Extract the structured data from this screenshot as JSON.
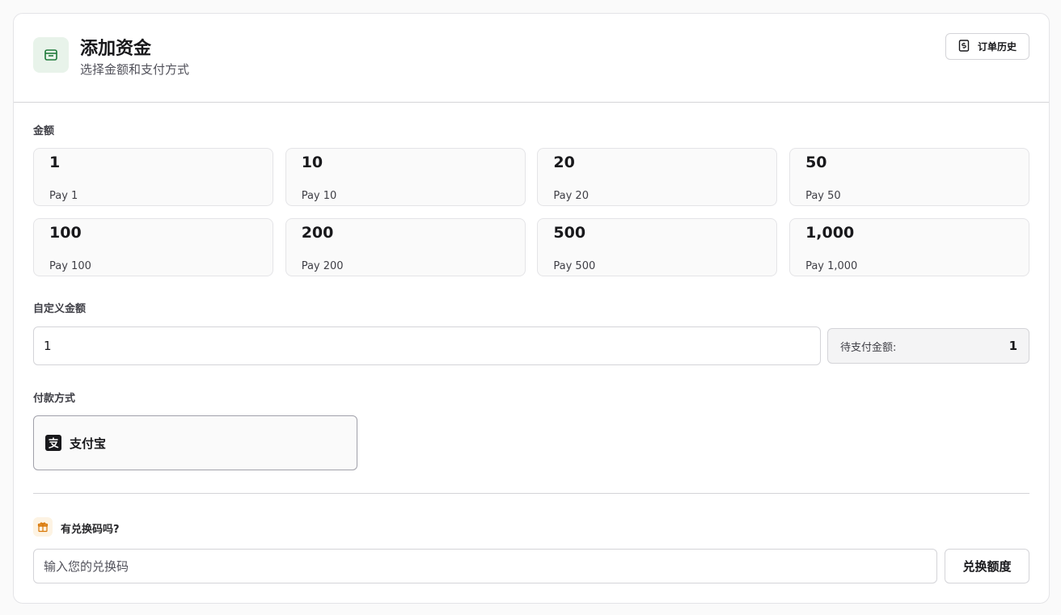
{
  "header": {
    "title": "添加资金",
    "subtitle": "选择金额和支付方式",
    "history_label": "订单历史",
    "icon": "wallet-icon",
    "icon_color": "#1f7a3a"
  },
  "amount": {
    "label": "金额",
    "options": [
      {
        "value": "1",
        "pay": "Pay 1"
      },
      {
        "value": "10",
        "pay": "Pay 10"
      },
      {
        "value": "20",
        "pay": "Pay 20"
      },
      {
        "value": "50",
        "pay": "Pay 50"
      },
      {
        "value": "100",
        "pay": "Pay 100"
      },
      {
        "value": "200",
        "pay": "Pay 200"
      },
      {
        "value": "500",
        "pay": "Pay 500"
      },
      {
        "value": "1,000",
        "pay": "Pay 1,000"
      }
    ]
  },
  "custom": {
    "label": "自定义金额",
    "value": "1",
    "pending_label": "待支付金额:",
    "pending_value": "1"
  },
  "payment": {
    "label": "付款方式",
    "method": "支付宝",
    "method_icon": "alipay-icon"
  },
  "redeem": {
    "question": "有兑换码吗?",
    "placeholder": "输入您的兑换码",
    "button": "兑换额度",
    "icon": "gift-icon",
    "icon_color": "#d97706"
  }
}
